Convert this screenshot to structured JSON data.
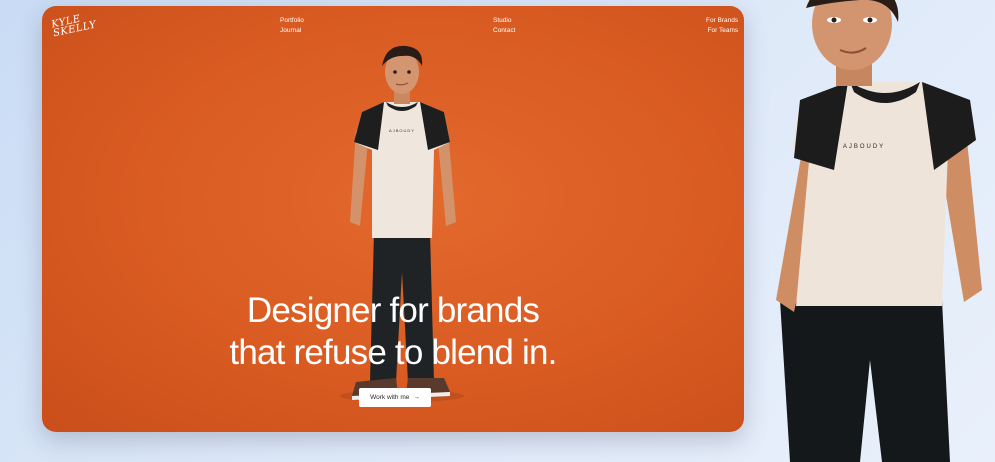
{
  "logo": {
    "line1": "KYLE",
    "line2": "SKELLY"
  },
  "nav": {
    "col1": [
      "Portfolio",
      "Journal"
    ],
    "col2": [
      "Studio",
      "Contact"
    ],
    "col3": [
      "For Brands",
      "For Teams"
    ]
  },
  "hero": {
    "headline_line1": "Designer for brands",
    "headline_line2": "that refuse to blend in.",
    "cta_label": "Work with me",
    "cta_icon": "arrow-right-icon"
  },
  "shirt_text": "AJBOUDY",
  "colors": {
    "accent": "#d95b22",
    "background": "#dce8f8",
    "text": "#ffffff"
  }
}
